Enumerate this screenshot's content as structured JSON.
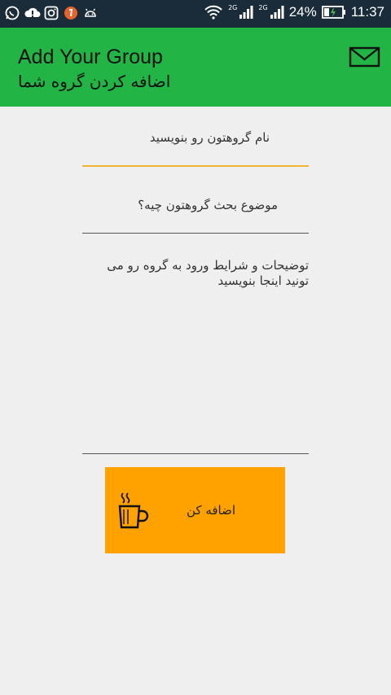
{
  "status_bar": {
    "left_icons": [
      "whatsapp-icon",
      "cloud-upload-icon",
      "instagram-icon",
      "app-notification-icon",
      "android-icon"
    ],
    "network_labels": [
      "2G",
      "2G"
    ],
    "battery_percent": "24%",
    "time": "11:37"
  },
  "toolbar": {
    "title_en": "Add Your Group",
    "title_fa": "اضافه کردن گروه شما",
    "action_icon": "mail-icon"
  },
  "form": {
    "group_name_hint": "نام گروهتون رو بنویسید",
    "topic_hint": "موضوع بحث گروهتون چیه؟",
    "description_hint": "توضیحات و شرایط ورود به گروه رو می تونید اینجا بنویسید",
    "submit_label": "اضافه کن",
    "submit_icon": "coffee-cup-icon"
  },
  "colors": {
    "status_bar": "#1a2c3a",
    "toolbar": "#22b445",
    "accent_underline": "#f2b632",
    "button": "#ffa200",
    "background": "#efefef"
  }
}
